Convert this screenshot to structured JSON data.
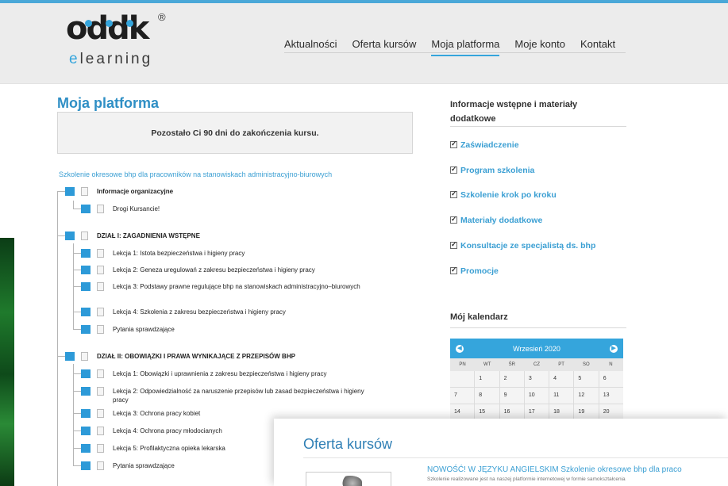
{
  "colors": {
    "accent": "#35a5dc",
    "link": "#3b9fd3",
    "header_bg": "#ececec"
  },
  "logo": {
    "mark": "oddk",
    "registered": "®",
    "sub": "elearning"
  },
  "nav": [
    {
      "label": "Aktualności",
      "active": false
    },
    {
      "label": "Oferta kursów",
      "active": false
    },
    {
      "label": "Moja platforma",
      "active": true
    },
    {
      "label": "Moje konto",
      "active": false
    },
    {
      "label": "Kontakt",
      "active": false
    }
  ],
  "main": {
    "title": "Moja platforma",
    "notice": "Pozostało Ci 90 dni do zakończenia kursu.",
    "course_title": "Szkolenie okresowe bhp dla pracowników na stanowiskach administracyjno-biurowych",
    "tree": [
      {
        "type": "section",
        "label": "Informacje organizacyjne"
      },
      {
        "type": "item",
        "label": "Drogi Kursancie!"
      },
      {
        "type": "section",
        "label": "DZIAŁ I: ZAGADNIENIA WSTĘPNE"
      },
      {
        "type": "item",
        "label": "Lekcja 1: Istota bezpieczeństwa i higieny pracy"
      },
      {
        "type": "item",
        "label": "Lekcja 2: Geneza uregulowań z zakresu bezpieczeństwa i higieny pracy"
      },
      {
        "type": "item",
        "label": "Lekcja 3: Podstawy prawne regulujące bhp na stanowiskach administracyjno–biurowych"
      },
      {
        "type": "item",
        "label": "Lekcja 4: Szkolenia z zakresu bezpieczeństwa i higieny pracy"
      },
      {
        "type": "item",
        "label": "Pytania sprawdzające"
      },
      {
        "type": "section",
        "label": "DZIAŁ II: OBOWIĄZKI I PRAWA WYNIKAJĄCE Z PRZEPISÓW BHP"
      },
      {
        "type": "item",
        "label": "Lekcja 1: Obowiązki i uprawnienia z zakresu bezpieczeństwa i higieny pracy"
      },
      {
        "type": "item",
        "label": "Lekcja 2: Odpowiedzialność za naruszenie przepisów lub zasad bezpieczeństwa i higieny pracy"
      },
      {
        "type": "item",
        "label": "Lekcja 3: Ochrona pracy kobiet"
      },
      {
        "type": "item",
        "label": "Lekcja 4: Ochrona pracy młodocianych"
      },
      {
        "type": "item",
        "label": "Lekcja 5: Profilaktyczna opieka lekarska"
      },
      {
        "type": "item",
        "label": "Pytania sprawdzające"
      }
    ]
  },
  "sidebar": {
    "info_title": "Informacje wstępne i materiały dodatkowe",
    "links": [
      "Zaświadczenie",
      "Program szkolenia",
      "Szkolenie krok po kroku",
      "Materiały dodatkowe",
      "Konsultacje ze specjalistą ds. bhp",
      "Promocje"
    ],
    "calendar_title": "Mój kalendarz",
    "calendar": {
      "month": "Wrzesień 2020",
      "weekdays": [
        "PN",
        "WT",
        "ŚR",
        "CZ",
        "PT",
        "SO",
        "N"
      ],
      "rows": [
        [
          "",
          "1",
          "2",
          "3",
          "4",
          "5",
          "6"
        ],
        [
          "7",
          "8",
          "9",
          "10",
          "11",
          "12",
          "13"
        ],
        [
          "14",
          "15",
          "16",
          "17",
          "18",
          "19",
          "20"
        ]
      ]
    }
  },
  "overlay": {
    "title": "Oferta kursów",
    "news_title": "NOWOŚĆ! W JĘZYKU ANGIELSKIM Szkolenie okresowe bhp dla praco",
    "news_desc": "Szkolenie realizowane jest na naszej platformie internetowej w formie samokształcenia"
  }
}
